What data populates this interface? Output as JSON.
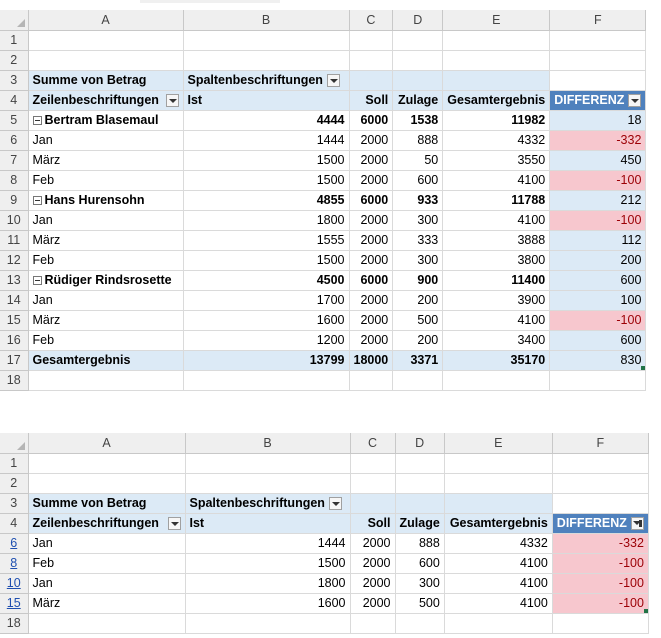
{
  "columns": [
    "A",
    "B",
    "C",
    "D",
    "E",
    "F"
  ],
  "pivot_labels": {
    "summe": "Summe von Betrag",
    "spalten": "Spaltenbeschriftungen",
    "zeilen": "Zeilenbeschriftungen",
    "ist": "Ist",
    "soll": "Soll",
    "zulage": "Zulage",
    "gesamt": "Gesamtergebnis",
    "differenz": "DIFFERENZ"
  },
  "sheet1": {
    "rows": [
      {
        "n": "5",
        "type": "group",
        "label": "Bertram Blasemaul",
        "ist": "4444",
        "soll": "6000",
        "zulage": "1538",
        "gesamt": "11982",
        "diff": "18",
        "neg": false
      },
      {
        "n": "6",
        "type": "item",
        "label": "Jan",
        "ist": "1444",
        "soll": "2000",
        "zulage": "888",
        "gesamt": "4332",
        "diff": "-332",
        "neg": true
      },
      {
        "n": "7",
        "type": "item",
        "label": "März",
        "ist": "1500",
        "soll": "2000",
        "zulage": "50",
        "gesamt": "3550",
        "diff": "450",
        "neg": false
      },
      {
        "n": "8",
        "type": "item",
        "label": "Feb",
        "ist": "1500",
        "soll": "2000",
        "zulage": "600",
        "gesamt": "4100",
        "diff": "-100",
        "neg": true
      },
      {
        "n": "9",
        "type": "group",
        "label": "Hans Hurensohn",
        "ist": "4855",
        "soll": "6000",
        "zulage": "933",
        "gesamt": "11788",
        "diff": "212",
        "neg": false
      },
      {
        "n": "10",
        "type": "item",
        "label": "Jan",
        "ist": "1800",
        "soll": "2000",
        "zulage": "300",
        "gesamt": "4100",
        "diff": "-100",
        "neg": true
      },
      {
        "n": "11",
        "type": "item",
        "label": "März",
        "ist": "1555",
        "soll": "2000",
        "zulage": "333",
        "gesamt": "3888",
        "diff": "112",
        "neg": false
      },
      {
        "n": "12",
        "type": "item",
        "label": "Feb",
        "ist": "1500",
        "soll": "2000",
        "zulage": "300",
        "gesamt": "3800",
        "diff": "200",
        "neg": false
      },
      {
        "n": "13",
        "type": "group",
        "label": "Rüdiger Rindsrosette",
        "ist": "4500",
        "soll": "6000",
        "zulage": "900",
        "gesamt": "11400",
        "diff": "600",
        "neg": false
      },
      {
        "n": "14",
        "type": "item",
        "label": "Jan",
        "ist": "1700",
        "soll": "2000",
        "zulage": "200",
        "gesamt": "3900",
        "diff": "100",
        "neg": false
      },
      {
        "n": "15",
        "type": "item",
        "label": "März",
        "ist": "1600",
        "soll": "2000",
        "zulage": "500",
        "gesamt": "4100",
        "diff": "-100",
        "neg": true
      },
      {
        "n": "16",
        "type": "item",
        "label": "Feb",
        "ist": "1200",
        "soll": "2000",
        "zulage": "200",
        "gesamt": "3400",
        "diff": "600",
        "neg": false
      }
    ],
    "total": {
      "n": "17",
      "label": "Gesamtergebnis",
      "ist": "13799",
      "soll": "18000",
      "zulage": "3371",
      "gesamt": "35170",
      "diff": "830"
    }
  },
  "sheet2": {
    "rows": [
      {
        "n": "6",
        "label": "Jan",
        "ist": "1444",
        "soll": "2000",
        "zulage": "888",
        "gesamt": "4332",
        "diff": "-332"
      },
      {
        "n": "8",
        "label": "Feb",
        "ist": "1500",
        "soll": "2000",
        "zulage": "600",
        "gesamt": "4100",
        "diff": "-100"
      },
      {
        "n": "10",
        "label": "Jan",
        "ist": "1800",
        "soll": "2000",
        "zulage": "300",
        "gesamt": "4100",
        "diff": "-100"
      },
      {
        "n": "15",
        "label": "März",
        "ist": "1600",
        "soll": "2000",
        "zulage": "500",
        "gesamt": "4100",
        "diff": "-100"
      }
    ],
    "after_row": "18"
  },
  "row_numbers": {
    "r1": "1",
    "r2": "2",
    "r3": "3",
    "r4": "4",
    "r18": "18"
  }
}
